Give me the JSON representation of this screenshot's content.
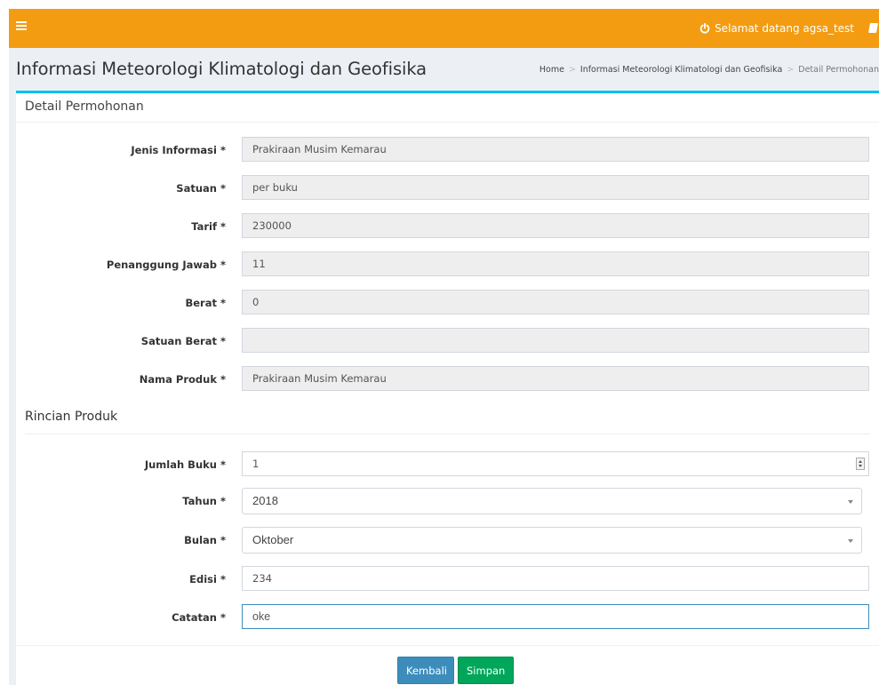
{
  "header": {
    "welcome_text": "Selamat datang agsa_test",
    "menu_icon": "hamburger-menu-icon",
    "power_icon": "power-icon",
    "extra_icon": "book-icon",
    "color": "#f39c12"
  },
  "page": {
    "title": "Informasi Meteorologi Klimatologi dan Geofisika"
  },
  "breadcrumb": {
    "items": [
      "Home",
      "Informasi Meteorologi Klimatologi dan Geofisika",
      "Detail Permohonan"
    ]
  },
  "detail": {
    "title": "Detail Permohonan",
    "fields": [
      {
        "label": "Jenis Informasi *",
        "value": "Prakiraan Musim Kemarau"
      },
      {
        "label": "Satuan *",
        "value": "per buku"
      },
      {
        "label": "Tarif *",
        "value": "230000"
      },
      {
        "label": "Penanggung Jawab *",
        "value": "11"
      },
      {
        "label": "Berat *",
        "value": "0"
      },
      {
        "label": "Satuan Berat *",
        "value": ""
      },
      {
        "label": "Nama Produk *",
        "value": "Prakiraan Musim Kemarau"
      }
    ]
  },
  "rincian": {
    "title": "Rincian Produk",
    "jumlah_buku": {
      "label": "Jumlah Buku *",
      "value": "1"
    },
    "tahun": {
      "label": "Tahun *",
      "value": "2018"
    },
    "bulan": {
      "label": "Bulan *",
      "value": "Oktober"
    },
    "edisi": {
      "label": "Edisi *",
      "value": "234"
    },
    "catatan": {
      "label": "Catatan *",
      "value": "oke"
    }
  },
  "buttons": {
    "back_label": "Kembali",
    "save_label": "Simpan"
  },
  "colors": {
    "accent": "#00c0ef",
    "primary": "#3c8dbc",
    "success": "#00a65a"
  }
}
